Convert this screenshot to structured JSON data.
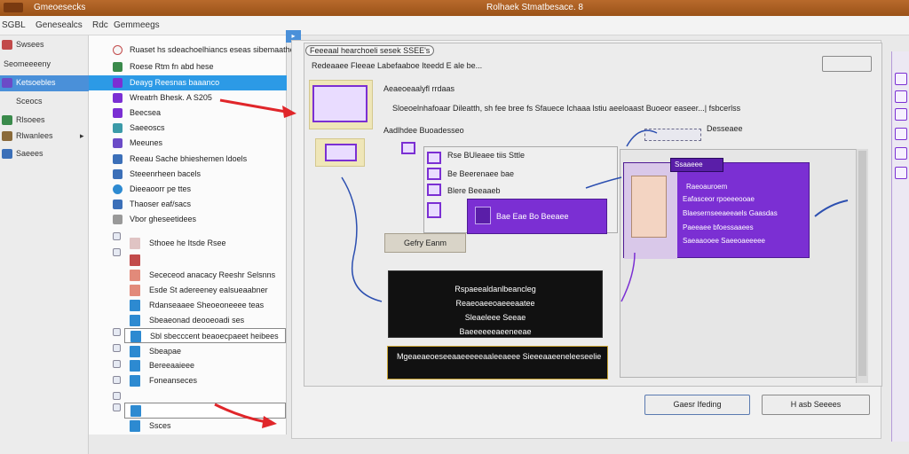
{
  "titlebar": {
    "app_name": "Gmeoesecks",
    "window_title": "Rolhaek Stmatbesace. 8"
  },
  "menubar": {
    "items": [
      "SGBL",
      "Genesealcs",
      "Rdc",
      "Gemmeegs"
    ]
  },
  "leftnav": {
    "items": [
      {
        "label": "Swsees",
        "icon_color": "#c24a4a"
      },
      {
        "label": "Seomeeeeny",
        "icon_color": "#c98b3a"
      },
      {
        "label": "Ketsoebles",
        "icon_color": "#6b4bc7",
        "active": true
      },
      {
        "label": "Sceocs",
        "icon_color": "#3b6fb8"
      },
      {
        "label": "Rlsoees",
        "icon_color": "#3a8a4b"
      },
      {
        "label": "Rlwanlees",
        "icon_color": "#8a6a3a"
      },
      {
        "label": "Saeees",
        "icon_color": "#3b6fb8"
      }
    ]
  },
  "list": {
    "rows": [
      {
        "label": "Ruaset hs sdeachoelhiancs eseas sibemaathe",
        "icon_color": "#f0f0f0"
      },
      {
        "label": "Roese Rtm fn abd hese",
        "icon_color": "#3a8a4b"
      },
      {
        "label": "Deayg Reesnas baaanco",
        "icon_color": "#7b2fd3",
        "selected": true
      },
      {
        "label": "Wreatrh Bhesk. A S205",
        "icon_color": "#7b2fd3"
      },
      {
        "label": "Beecsea",
        "icon_color": "#7b2fd3"
      },
      {
        "label": "Saeeoscs",
        "icon_color": "#3b9aa8"
      },
      {
        "label": "Meeunes",
        "icon_color": "#6b4bc7"
      },
      {
        "label": "Reeau Sache bhieshemen ldoels",
        "icon_color": "#3b6fb8"
      },
      {
        "label": "Steeenrheen bacels",
        "icon_color": "#3b6fb8"
      },
      {
        "label": "Dieeaoorr pe ttes",
        "icon_color": "#2d8ad1"
      },
      {
        "label": "Thaoser eaf/sacs",
        "icon_color": "#3b6fb8"
      },
      {
        "label": "Vbor gheseetidees",
        "icon_color": "#999999"
      }
    ],
    "subrows": [
      {
        "label": "Sthoee he Itsde Rsee",
        "icon_color": "#e0c4c4"
      },
      {
        "label": "",
        "icon_color": "#c24a4a"
      },
      {
        "label": "Sececeod anacacy Reeshr Selsnns",
        "icon_color": "#e28a7a"
      },
      {
        "label": "Esde St adereeney ealsueaabner",
        "icon_color": "#e28a7a"
      },
      {
        "label": "Rdanseaaee Sheoeoneeee teas",
        "icon_color": "#2d8ad1"
      },
      {
        "label": "Sbeaeonad deooeoadi ses",
        "icon_color": "#2d8ad1"
      },
      {
        "label": "Sbl sbecccent beaoecpaeet heibees",
        "icon_color": "#2d8ad1",
        "boxed": true
      },
      {
        "label": "Sbeapae",
        "icon_color": "#2d8ad1"
      },
      {
        "label": "Bereeaaieee",
        "icon_color": "#2d8ad1"
      },
      {
        "label": "Foneanseces",
        "icon_color": "#2d8ad1"
      },
      {
        "label": "",
        "icon_color": "#2d8ad1",
        "boxed": true
      },
      {
        "label": "Ssces",
        "icon_color": "#2d8ad1"
      }
    ]
  },
  "main": {
    "header_label": "Feeeaal hearchoeli sesek SSEE's",
    "subheader": "Redeaaee Fleeae Labefaaboe Iteedd E ale be...",
    "top_right_button": "",
    "desc_line1": "Aeaeoeaalyfl rrdaas",
    "desc_line2": "Sloeoelnhafoaar Dileatth, sh fee bree fs Sfauece Ichaaa lstiu aeeloaast Buoeor easeer...| fsbcerlss",
    "desc_line3": "Aadlhdee Buoadesseo",
    "items": [
      "Rse BUleaee tiis Sttle",
      "Be Beerenaee bae",
      "Blere Beeaaeb"
    ],
    "purple_card_text": "Bae Eae Bo Beeaee",
    "pill": "Gefry Eanm",
    "dark_box_lines": [
      "Rspaeealdanlbeancleg",
      "Reaeoaeeoaeeeaatee",
      "Sleaeleee Seeae",
      "Baeeeeeeaeeneeae"
    ],
    "dark_bar_text": "Mgeaeaeoeseeaaeeeeeaaleeaeee Sieeeaaeeneleeseelieee",
    "rightpanel": {
      "top_label": "Desseaee",
      "tile_title": "Ssaaeee",
      "lines": [
        "Raeoauroem",
        "Eafasceor rpoeeeooae",
        "Blaesernseeaeeaels Gaasdas",
        "Paeeaee bfoessaaees",
        "Saeaaooee Saeeoaeeeee"
      ]
    },
    "buttons": {
      "left": "Gaesr Ifeding",
      "right": "H asb Seeees"
    }
  },
  "colors": {
    "accent": "#7b2fd3",
    "select": "#2c9ae6",
    "titlebar": "#a35a1f"
  }
}
